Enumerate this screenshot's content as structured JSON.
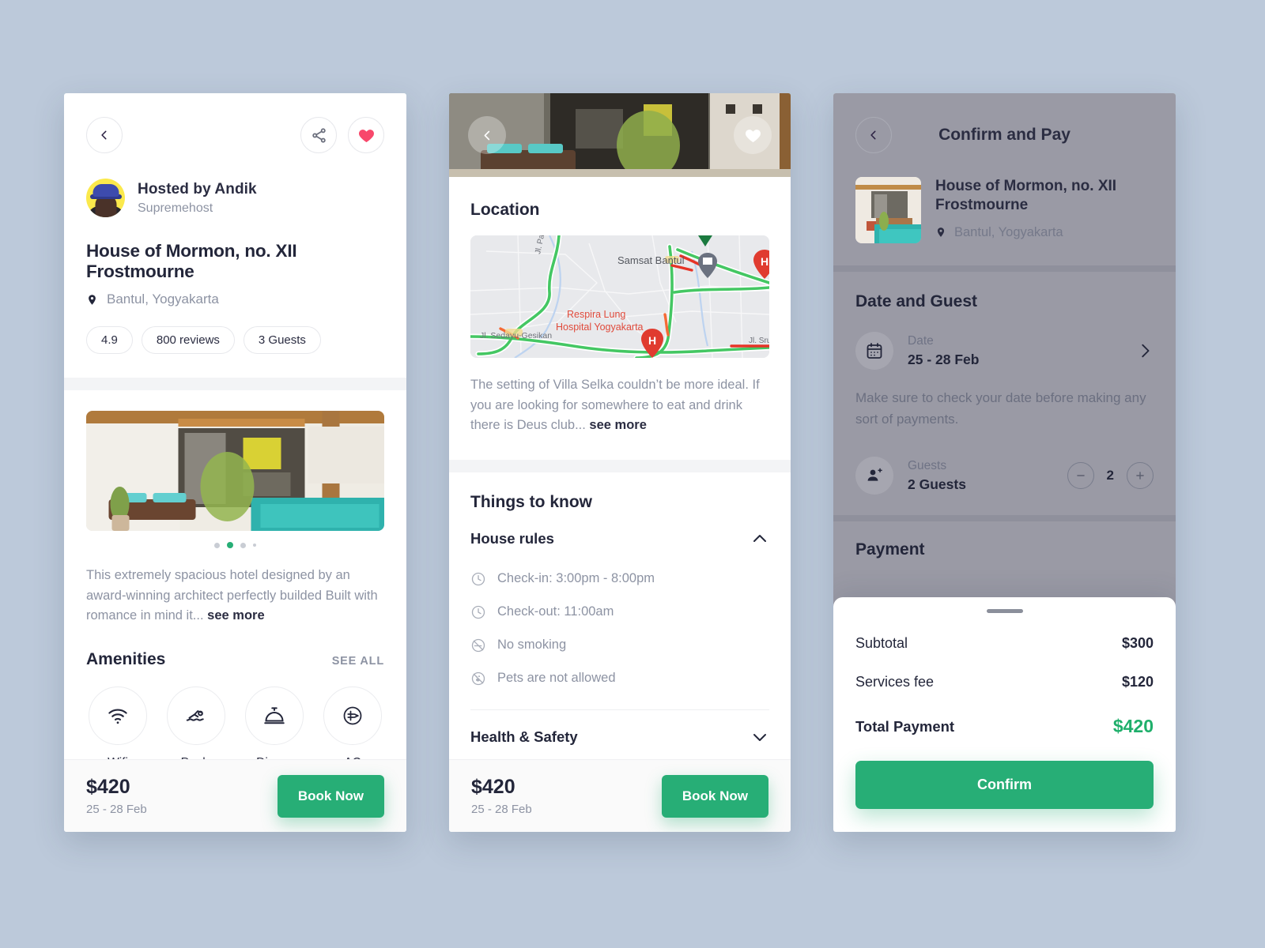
{
  "theme": {
    "background": "#bcc9da",
    "accent_green": "#27ae76",
    "heart_pink": "#f8486b",
    "text_dark": "#23263a",
    "text_muted": "#8d93a3"
  },
  "detail_screen": {
    "back_icon": "chevron-left-icon",
    "share_icon": "share-icon",
    "favorite_icon": "heart-icon",
    "host": {
      "name": "Hosted by Andik",
      "badge": "Supremehost",
      "avatar": "host-avatar"
    },
    "title": "House of Mormon, no. XII Frostmourne",
    "location": "Bantul, Yogyakarta",
    "chips": [
      "4.9",
      "800 reviews",
      "3 Guests"
    ],
    "gallery": {
      "dots_total": 4,
      "active_index": 1
    },
    "description": "This extremely spacious hotel designed by an award-winning architect perfectly builded Built with romance in mind it...",
    "description_more": "see more",
    "amenities_title": "Amenities",
    "see_all": "SEE ALL",
    "amenities": [
      {
        "label": "Wifi",
        "icon": "wifi-icon"
      },
      {
        "label": "Pools",
        "icon": "swimmer-icon"
      },
      {
        "label": "Dinner",
        "icon": "room-service-bell-icon"
      },
      {
        "label": "AC",
        "icon": "air-conditioner-icon"
      }
    ],
    "price": "$420",
    "price_dates": "25 - 28 Feb",
    "book_button": "Book Now"
  },
  "location_screen": {
    "back_icon": "chevron-left-icon",
    "favorite_icon": "heart-icon",
    "location_title": "Location",
    "map": {
      "labels": [
        "Samsat Bantul",
        "Respira Lung Hospital Yogyakarta",
        "Jl. Sedayu-Gesikan",
        "Jl. Pa"
      ],
      "markers": [
        "museum-marker",
        "hospital-marker",
        "destination-marker"
      ]
    },
    "location_text": "The setting of Villa Selka couldn’t be more ideal. If you are looking for somewhere to eat and drink there is Deus club...",
    "location_more": "see more",
    "things_title": "Things to know",
    "house_rules": {
      "title": "House rules",
      "expanded": true,
      "toggle_icon": "chevron-up-icon",
      "items": [
        {
          "text": "Check-in: 3:00pm - 8:00pm",
          "icon": "clock-icon"
        },
        {
          "text": "Check-out: 11:00am",
          "icon": "clock-icon"
        },
        {
          "text": "No smoking",
          "icon": "no-smoking-icon"
        },
        {
          "text": "Pets are not allowed",
          "icon": "no-pets-icon"
        }
      ]
    },
    "health_safety": {
      "title": "Health & Safety",
      "expanded": false,
      "toggle_icon": "chevron-down-icon"
    },
    "price": "$420",
    "price_dates": "25 - 28 Feb",
    "book_button": "Book Now"
  },
  "payment_screen": {
    "back_icon": "chevron-left-icon",
    "title": "Confirm and Pay",
    "property": {
      "name": "House of Mormon, no. XII Frostmourne",
      "location": "Bantul, Yogyakarta",
      "location_icon": "map-pin-icon",
      "thumbnail": "property-thumbnail"
    },
    "date_guest": {
      "section_title": "Date and Guest",
      "date_label": "Date",
      "date_value": "25 - 28 Feb",
      "date_icon": "calendar-icon",
      "date_chevron": "chevron-right-icon",
      "note": "Make sure to check your date before making any sort of payments.",
      "guests_label": "Guests",
      "guests_value": "2 Guests",
      "guests_icon": "add-person-icon",
      "guest_count": "2",
      "minus_icon": "minus-icon",
      "plus_icon": "plus-icon"
    },
    "payment_section_title": "Payment",
    "sheet": {
      "grabber": "drag-handle",
      "rows": [
        {
          "label": "Subtotal",
          "amount": "$300"
        },
        {
          "label": "Services fee",
          "amount": "$120"
        }
      ],
      "total_label": "Total Payment",
      "total_amount": "$420",
      "confirm_button": "Confirm"
    }
  }
}
